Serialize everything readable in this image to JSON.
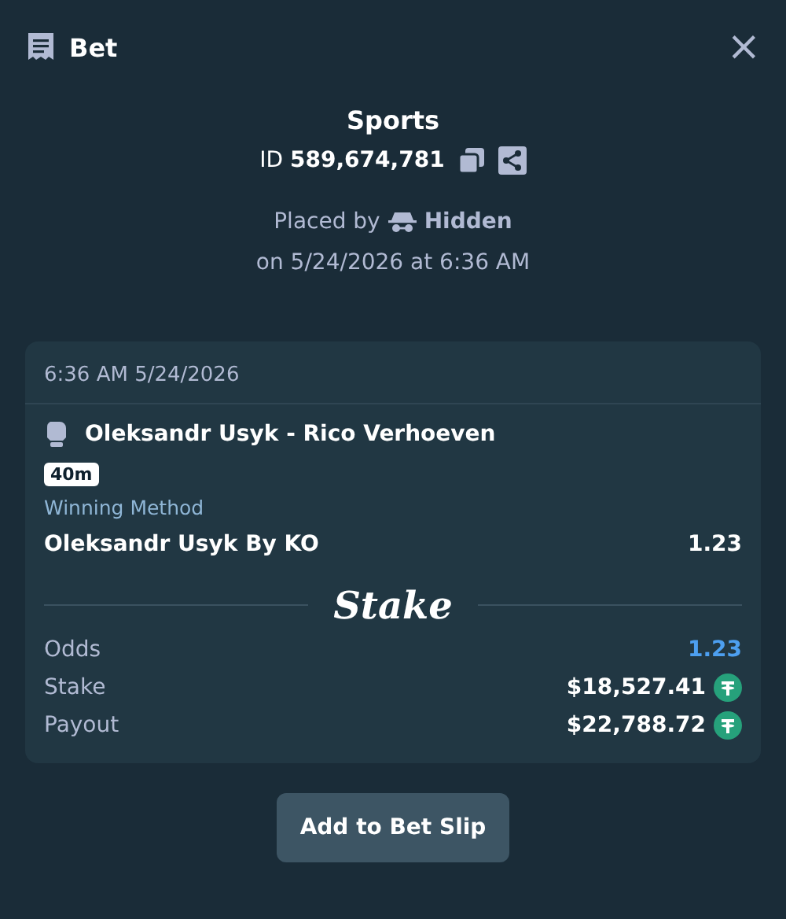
{
  "header": {
    "title": "Bet",
    "close": "×"
  },
  "summary": {
    "category": "Sports",
    "id_line": "ID **589,674,781**",
    "placed_by_prefix": "Placed by",
    "placed_by": "Hidden",
    "placed_on": "on 5/24/2026 at 6:36 AM"
  },
  "card": {
    "timestamp": "6:36 AM 5/24/2026",
    "event": "Oleksandr Usyk - Rico Verhoeven",
    "time_badge": "40m",
    "market": "Winning Method",
    "selection": "Oleksandr Usyk By KO",
    "selection_odds": "1.23",
    "logo": "Stake",
    "rows": [
      {
        "label": "Odds",
        "value": "1.23",
        "kind": "odds"
      },
      {
        "label": "Stake",
        "value": "$18,527.41",
        "kind": "amount"
      },
      {
        "label": "Payout",
        "value": "$22,788.72",
        "kind": "amount"
      }
    ]
  },
  "button": "Add to Bet Slip"
}
